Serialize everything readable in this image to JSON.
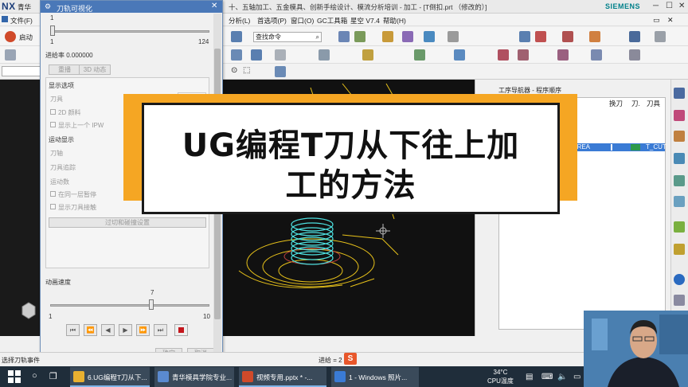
{
  "titlebar": {
    "logo": "NX",
    "app_prefix": "青华",
    "title": "十、五轴加工、五金模具、创新手绘设计、模流分析培训 - 加工 - [T倒扣.prt （修改的）]",
    "brand": "SIEMENS"
  },
  "menubar": {
    "file": "文件(F)",
    "items": [
      "分析(L)",
      "首选项(P)",
      "窗口(O)",
      "GC工具箱",
      "星空 V7.4",
      "帮助(H)"
    ]
  },
  "toolbar": {
    "start_label": "启动",
    "search_placeholder": "查找命令"
  },
  "dialog": {
    "title": "刀轨可视化",
    "slider_top": {
      "min": "1",
      "max": "124",
      "current": "1"
    },
    "progress_label": "进给率 0.000000",
    "tabs": [
      "重播",
      "3D 动态"
    ],
    "display_options_label": "显示选项",
    "tool_label": "刀具",
    "check_2d_material": "2D 颜料",
    "check_show_prev_ipw": "显示上一个 IPW",
    "motion_display_label": "运动显示",
    "tool_axis_label": "刀轴",
    "tool_trace_label": "刀具追踪",
    "motion_count_label": "运动数",
    "check_same_layer": "在同一层暂停",
    "check_show_tool_tip": "显示刀具接触",
    "create_list_button": "过切和碰撞设置",
    "anim_speed_label": "动画速度",
    "anim_slider": {
      "min": "1",
      "max": "10",
      "current": "7"
    },
    "ok_button": "确定",
    "cancel_button": "取消"
  },
  "navigator": {
    "title": "工序导航器 - 程序顺序",
    "columns": [
      "换刀",
      "刀.",
      "刀具"
    ],
    "selected_row_name": "R_AREA",
    "selected_row_tool": "T_CUT"
  },
  "statusbar": {
    "left_text": "选择刀轨事件",
    "progress_text": "进给 = 2"
  },
  "taskbar": {
    "apps": [
      {
        "label": "6.UG编程T刀从下..."
      },
      {
        "label": "青华模具学院专业..."
      },
      {
        "label": "视频专用.pptx * -..."
      },
      {
        "label": "1 - Windows 照片..."
      }
    ],
    "temp": "34°C",
    "temp_label": "CPU温度"
  },
  "banner": {
    "line1": "UG编程T刀从下往上加",
    "line2": "工的方法"
  },
  "colors": {
    "dialog_title": "#4a78b8",
    "banner_frame": "#f5a623",
    "selection": "#3a7bd5",
    "stop": "#c4161c",
    "toolpath_yellow": "#e8c21a",
    "toolpath_cyan": "#4de0e0"
  },
  "icons": [
    "gear-icon",
    "close-icon",
    "search-icon",
    "play-icon",
    "stop-icon",
    "windows-start-icon"
  ]
}
